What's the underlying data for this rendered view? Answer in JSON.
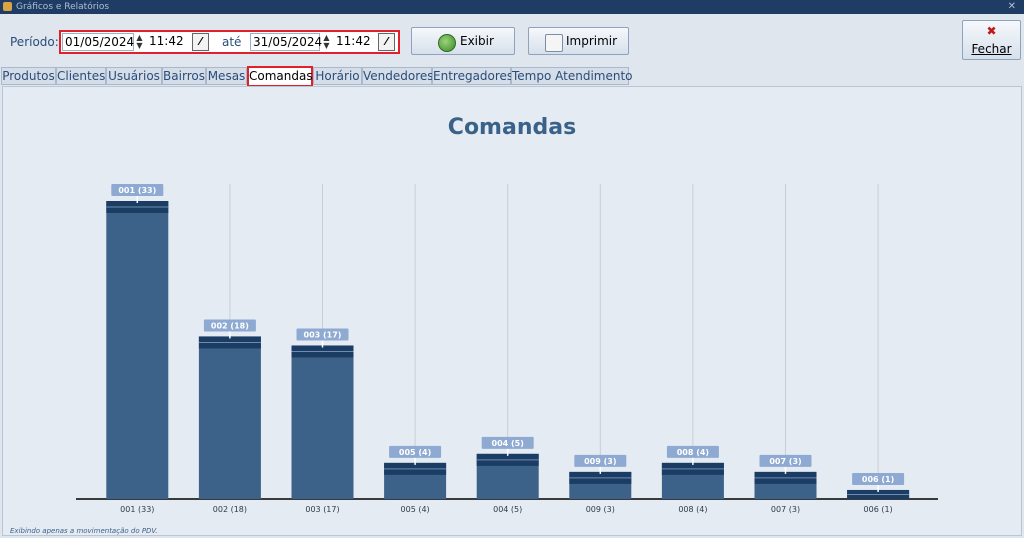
{
  "window": {
    "title": "Gráficos e Relatórios",
    "close_glyph": "✕"
  },
  "filter": {
    "period_label": "Período:",
    "start_date": "01/05/2024",
    "start_time": "11:42",
    "until_label": "até",
    "end_date": "31/05/2024",
    "end_time": "11:42"
  },
  "buttons": {
    "show": "Exibir",
    "print": "Imprimir",
    "close": "Fechar"
  },
  "tabs": [
    "Produtos",
    "Clientes",
    "Usuários",
    "Bairros",
    "Mesas",
    "Comandas",
    "Horário",
    "Vendedores",
    "Entregadores",
    "Tempo Atendimento"
  ],
  "active_tab": "Comandas",
  "chart_data": {
    "type": "bar",
    "title": "Comandas",
    "categories": [
      "001 (33)",
      "002 (18)",
      "003 (17)",
      "005 (4)",
      "004 (5)",
      "009 (3)",
      "008 (4)",
      "007 (3)",
      "006 (1)"
    ],
    "values": [
      33,
      18,
      17,
      4,
      5,
      3,
      4,
      3,
      1
    ],
    "bar_color": "#3d6289",
    "label_bg": "#8eaad2"
  },
  "footnote": "Exibindo apenas a movimentação do PDV."
}
